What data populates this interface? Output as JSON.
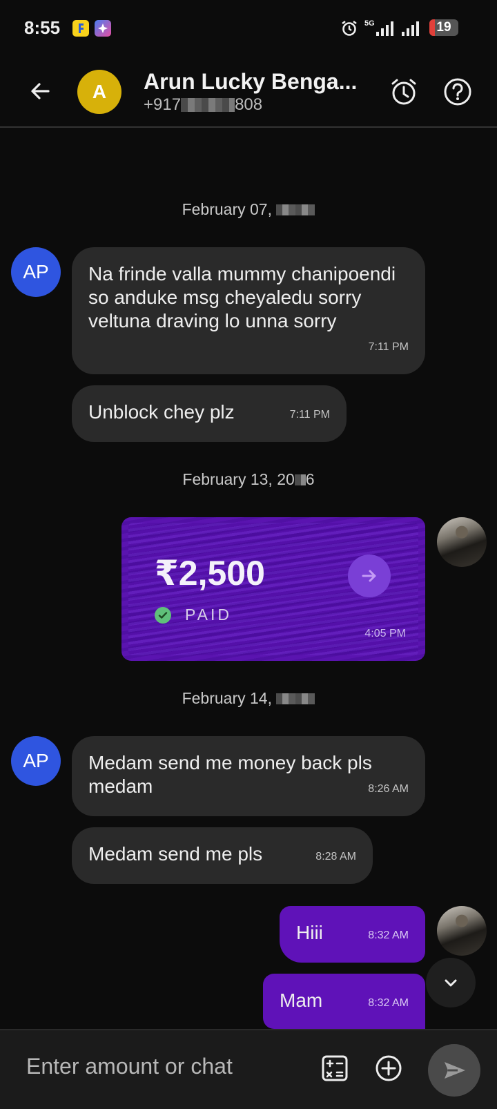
{
  "status_bar": {
    "time": "8:55",
    "network": "5G",
    "battery": "19",
    "battery_level": 0.19,
    "icons": [
      "flipkart-app-icon",
      "gallery-app-icon",
      "alarm-icon",
      "5g-signal-icon",
      "signal-icon",
      "battery-icon"
    ]
  },
  "header": {
    "contact_initial": "A",
    "contact_name": "Arun Lucky Benga...",
    "phone_prefix": "+917",
    "phone_suffix": "808",
    "avatar_color": "#d7b10a",
    "icons": [
      "back-arrow-icon",
      "alarm-clock-icon",
      "help-icon"
    ]
  },
  "chat": {
    "peer_initials": "AP",
    "peer_color": "#2f55e0",
    "date_1": "February 07,",
    "date_2_part1": "February 13, 20",
    "date_2_part2": "6",
    "date_3": "February 14,",
    "msg_1": "Na frinde valla mummy chanipoendi so anduke msg cheyaledu sorry veltuna draving lo unna sorry",
    "msg_1_time": "7:11 PM",
    "msg_2": "Unblock chey plz",
    "msg_2_time": "7:11 PM",
    "payment": {
      "amount": "₹2,500",
      "status": "PAID",
      "time": "4:05 PM"
    },
    "msg_3": "Medam send me money back pls medam",
    "msg_3_time": "8:26 AM",
    "msg_4": "Medam send me pls",
    "msg_4_time": "8:28 AM",
    "msg_5": "Hiii",
    "msg_5_time": "8:32 AM",
    "msg_6": "Mam",
    "msg_6_time": "8:32 AM",
    "outgoing_color": "#5f12b8"
  },
  "composer": {
    "placeholder": "Enter amount or chat",
    "icons": [
      "calculator-icon",
      "plus-circle-icon",
      "send-icon",
      "chevron-down-icon"
    ]
  }
}
